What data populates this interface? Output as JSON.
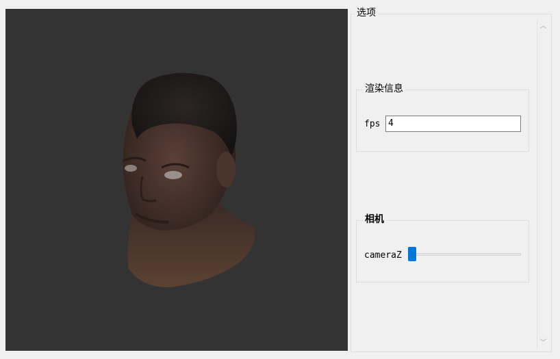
{
  "viewport": {
    "background": "#333333",
    "content": "3d-head-model"
  },
  "options": {
    "title": "选项",
    "render_info": {
      "title": "渲染信息",
      "fps_label": "fps",
      "fps_value": "4"
    },
    "camera": {
      "title": "相机",
      "camera_z_label": "cameraZ",
      "camera_z_value": 0.0
    }
  },
  "colors": {
    "accent": "#0078d7",
    "viewport_bg": "#333333",
    "panel_bg": "#f0f0f0"
  }
}
